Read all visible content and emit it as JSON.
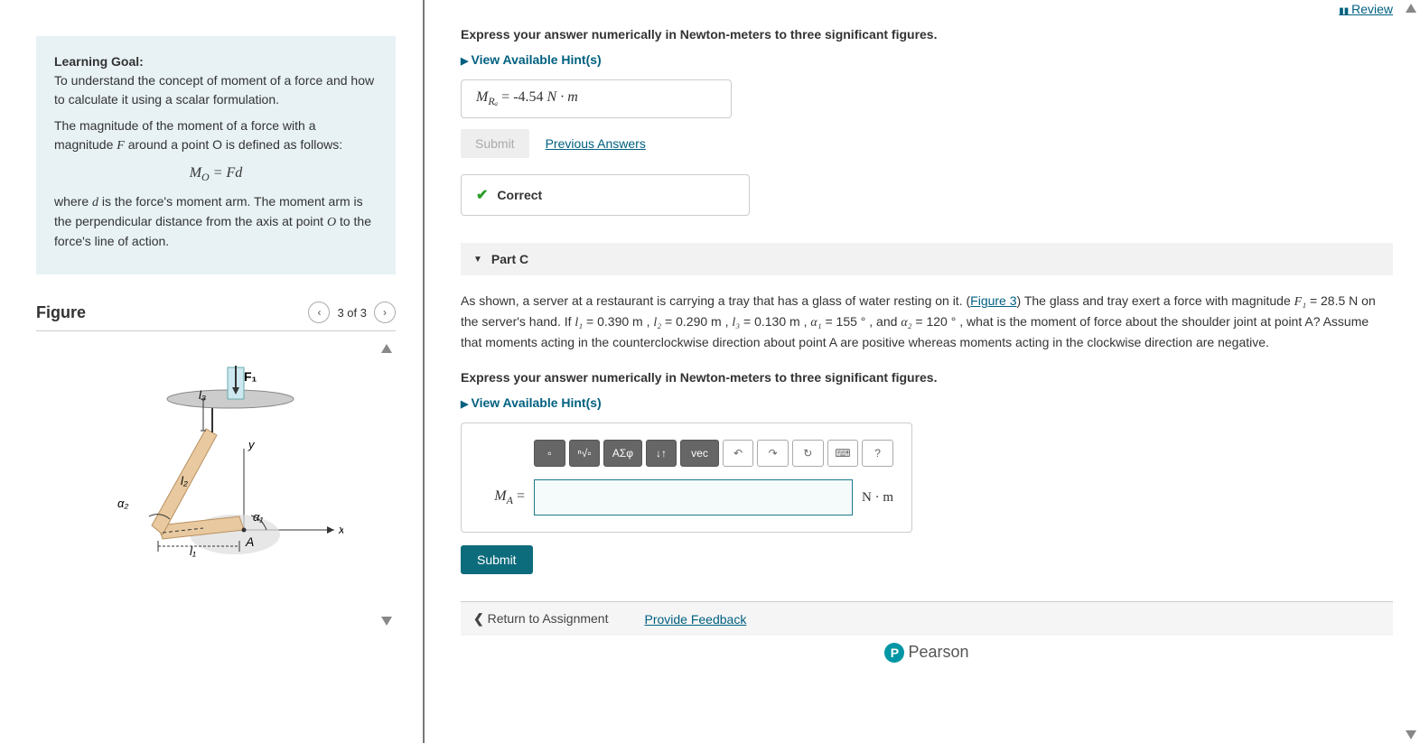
{
  "review_link": "Review",
  "goal": {
    "heading": "Learning Goal:",
    "intro": "To understand the concept of moment of a force and how to calculate it using a scalar formulation.",
    "p2_pre": "The magnitude of the moment of a force with a magnitude ",
    "p2_var": "F",
    "p2_post": " around a point O is defined as follows:",
    "formula_lhs": "M",
    "formula_sub": "O",
    "formula_rhs": " = Fd",
    "p3_a": "where ",
    "p3_d": "d",
    "p3_b": " is the force's moment arm. The moment arm is the perpendicular distance from the axis at point ",
    "p3_o": "O",
    "p3_c": " to the force's line of action."
  },
  "figure": {
    "title": "Figure",
    "counter": "3 of 3",
    "labels": {
      "F1": "F₁",
      "l1": "l₁",
      "l2": "l₂",
      "l3": "l₃",
      "a1": "α₁",
      "a2": "α₂",
      "A": "A",
      "x": "x",
      "y": "y"
    }
  },
  "partB": {
    "instruction": "Express your answer numerically in Newton-meters to three significant figures.",
    "hints": "View Available Hint(s)",
    "answer_var": "M",
    "answer_sub": "Rₐ",
    "answer_eq": " = ",
    "answer_val": "-4.54 ",
    "answer_unit": "N · m",
    "submit": "Submit",
    "prev": "Previous Answers",
    "correct": "Correct"
  },
  "partC": {
    "header": "Part C",
    "text_1": "As shown, a server at a restaurant is carrying a tray that has a glass of water resting on it. (",
    "fig_link": "Figure 3",
    "text_2": ") The glass and tray exert a force with magnitude ",
    "F1": "F₁",
    "F1v": " = 28.5 N",
    "text_3": " on the server's hand. If ",
    "l1": "l₁",
    "l1v": " = 0.390 m",
    "l2": "l₂",
    "l2v": " = 0.290 m",
    "l3": "l₃",
    "l3v": " = 0.130 m",
    "a1": "α₁",
    "a1v": " = 155 °",
    "a2": "α₂",
    "a2v": " = 120 °",
    "text_4": ", what is the moment of force about the shoulder joint at point A? Assume that moments acting in the counterclockwise direction about point A are positive whereas moments acting in the clockwise direction are negative.",
    "instruction": "Express your answer numerically in Newton-meters to three significant figures.",
    "hints": "View Available Hint(s)",
    "input_label_var": "M",
    "input_label_sub": "A",
    "input_label_eq": " = ",
    "unit": "N · m",
    "submit": "Submit",
    "tools": {
      "frac": "▫",
      "sqrt": "ⁿ√▫",
      "greek": "ΑΣφ",
      "arrows": "↓↑",
      "vec": "vec",
      "undo": "↶",
      "redo": "↷",
      "reset": "↻",
      "keyboard": "⌨",
      "help": "?"
    }
  },
  "footer": {
    "return": "Return to Assignment",
    "feedback": "Provide Feedback",
    "brand": "Pearson"
  },
  "chart_data": {
    "type": "diagram",
    "description": "Server arm holding tray with glass. Shoulder joint A at origin. Upper arm along l1 at angle α1=155° from +x, forearm l2 at α2=120° from upper-arm direction, hand segment l3 vertical to tray. Force F1=28.5N downward on tray.",
    "points": {
      "A": "shoulder joint origin"
    },
    "segments": [
      {
        "name": "l1",
        "value": 0.39,
        "unit": "m"
      },
      {
        "name": "l2",
        "value": 0.29,
        "unit": "m"
      },
      {
        "name": "l3",
        "value": 0.13,
        "unit": "m"
      }
    ],
    "angles": [
      {
        "name": "α1",
        "value": 155,
        "unit": "deg"
      },
      {
        "name": "α2",
        "value": 120,
        "unit": "deg"
      }
    ],
    "forces": [
      {
        "name": "F1",
        "value": 28.5,
        "unit": "N",
        "direction": "down"
      }
    ],
    "axes": [
      "x",
      "y"
    ]
  }
}
